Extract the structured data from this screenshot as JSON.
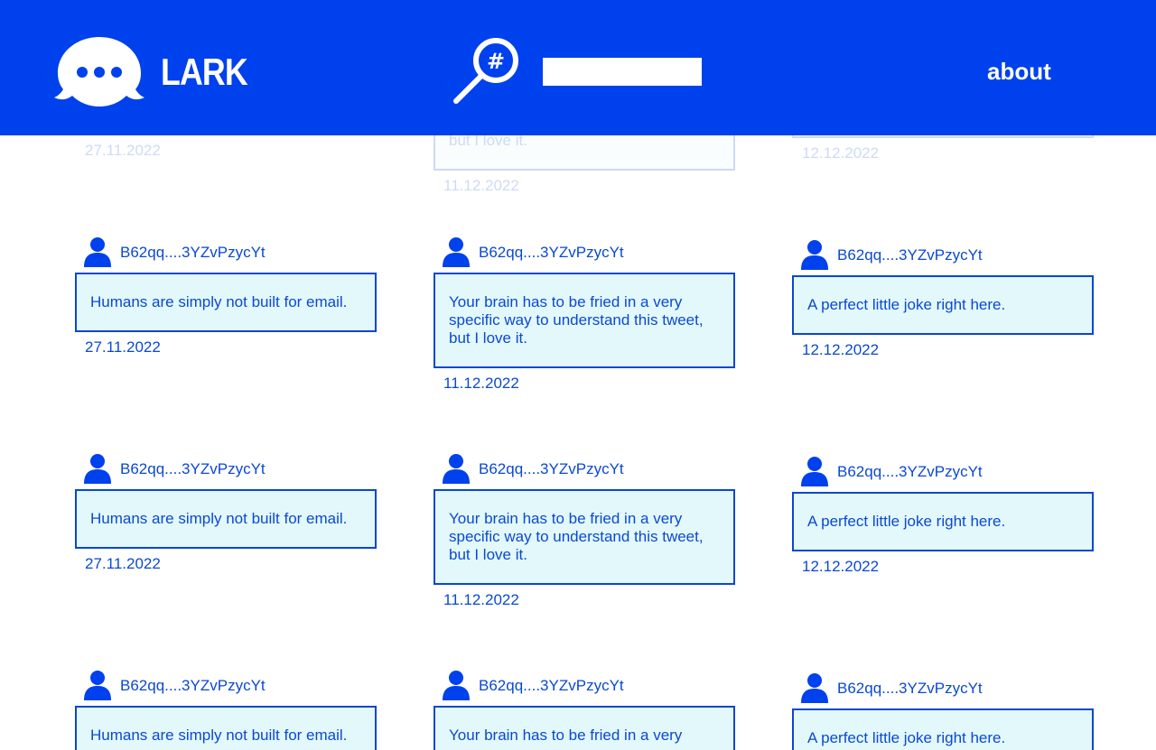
{
  "header": {
    "brand": "LARK",
    "search_placeholder": "",
    "about_label": "about",
    "colors": {
      "header_bg": "#0041ee",
      "text_blue": "#0a49d4",
      "bubble_bg": "#e3f8fb"
    }
  },
  "partial_row": {
    "col1": {
      "date": "27.11.2022"
    },
    "col2": {
      "text_tail": "but I love it.",
      "date": "11.12.2022"
    },
    "col3": {
      "date": "12.12.2022"
    }
  },
  "rows": [
    {
      "col1": {
        "author": "B62qq....3YZvPzycYt",
        "text": "Humans are simply not built for email.",
        "date": "27.11.2022"
      },
      "col2": {
        "author": "B62qq....3YZvPzycYt",
        "text": "Your brain has to be fried in a very specific way to understand this tweet, but I love it.",
        "date": "11.12.2022"
      },
      "col3": {
        "author": "B62qq....3YZvPzycYt",
        "text": "A perfect little joke right here.",
        "date": "12.12.2022"
      }
    },
    {
      "col1": {
        "author": "B62qq....3YZvPzycYt",
        "text": "Humans are simply not built for email.",
        "date": "27.11.2022"
      },
      "col2": {
        "author": "B62qq....3YZvPzycYt",
        "text": "Your brain has to be fried in a very specific way to understand this tweet, but I love it.",
        "date": "11.12.2022"
      },
      "col3": {
        "author": "B62qq....3YZvPzycYt",
        "text": "A perfect little joke right here.",
        "date": "12.12.2022"
      }
    },
    {
      "col1": {
        "author": "B62qq....3YZvPzycYt",
        "text": "Humans are simply not built for email."
      },
      "col2": {
        "author": "B62qq....3YZvPzycYt",
        "text": "Your brain has to be fried in a very"
      },
      "col3": {
        "author": "B62qq....3YZvPzycYt",
        "text": "A perfect little joke right here."
      }
    }
  ]
}
